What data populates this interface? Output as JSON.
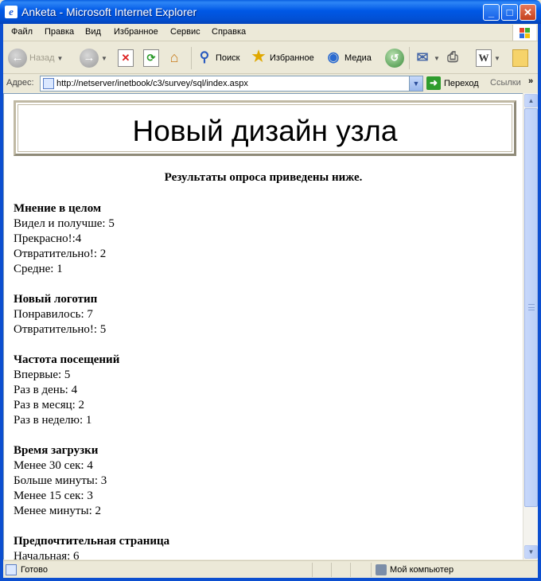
{
  "window": {
    "title": "Anketa - Microsoft Internet Explorer"
  },
  "menu": [
    "Файл",
    "Правка",
    "Вид",
    "Избранное",
    "Сервис",
    "Справка"
  ],
  "toolbar": {
    "back": "Назад",
    "search": "Поиск",
    "favorites": "Избранное",
    "media": "Медиа"
  },
  "address": {
    "label": "Адрес:",
    "url": "http://netserver/inetbook/c3/survey/sql/index.aspx",
    "go": "Переход",
    "links": "Ссылки",
    "links_more": "»"
  },
  "page": {
    "banner": "Новый дизайн узла",
    "results_heading": "Результаты опроса приведены ниже.",
    "questions": [
      {
        "title": "Мнение в целом",
        "answers": [
          "Видел и получше: 5",
          "Прекрасно!:4",
          "Отвратительно!: 2",
          "Средне: 1"
        ]
      },
      {
        "title": "Новый логотип",
        "answers": [
          "Понравилось: 7",
          "Отвратительно!: 5"
        ]
      },
      {
        "title": "Частота посещений",
        "answers": [
          "Впервые: 5",
          "Раз в день: 4",
          "Раз в месяц: 2",
          "Раз в неделю: 1"
        ]
      },
      {
        "title": "Время загрузки",
        "answers": [
          "Менее 30 сек: 4",
          "Больше минуты: 3",
          "Менее 15 сек: 3",
          "Менее минуты: 2"
        ]
      },
      {
        "title": "Предпочтительная страница",
        "answers": [
          "Начальная: 6"
        ]
      }
    ]
  },
  "status": {
    "text": "Готово",
    "zone": "Мой компьютер"
  }
}
